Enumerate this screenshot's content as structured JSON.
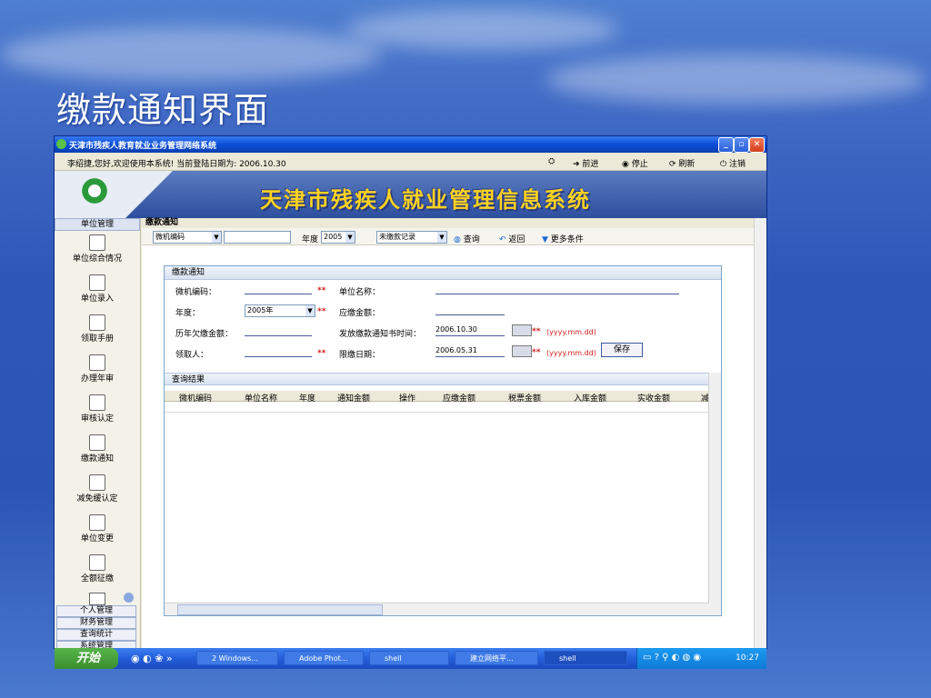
{
  "slide_title": "缴款通知界面",
  "window": {
    "title": "天津市残疾人教育就业业务管理网络系统"
  },
  "menubar": {
    "welcome": "李绍捷,您好,欢迎使用本系统! 当前登陆日期为: 2006.10.30",
    "actions": [
      "前进",
      "停止",
      "刷新",
      "注销"
    ]
  },
  "banner": {
    "title": "天津市残疾人就业管理信息系统"
  },
  "sidebar": {
    "header": "单位管理",
    "items": [
      {
        "label": "单位综合情况",
        "icon": "clip-icon"
      },
      {
        "label": "单位录入",
        "icon": "folder-icon"
      },
      {
        "label": "领取手册",
        "icon": "book-icon"
      },
      {
        "label": "办理年审",
        "icon": "document-icon"
      },
      {
        "label": "审核认定",
        "icon": "review-icon"
      },
      {
        "label": "缴款通知",
        "icon": "notice-icon"
      },
      {
        "label": "减免缓认定",
        "icon": "form-icon"
      },
      {
        "label": "单位变更",
        "icon": "network-icon"
      },
      {
        "label": "全额征缴",
        "icon": "document-icon"
      }
    ],
    "bottom": [
      "个人管理",
      "财务管理",
      "查询统计",
      "系统管理"
    ]
  },
  "main": {
    "header": "缴款通知",
    "toolbar": {
      "field_select": "微机编码",
      "year_label": "年度",
      "year_value": "2005",
      "status_select": "未缴款记录",
      "query": "查询",
      "back": "返回",
      "more": "更多条件"
    },
    "form": {
      "panel_title": "缴款通知",
      "code_label": "微机编码：",
      "unit_label": "单位名称：",
      "year_label": "年度：",
      "year_value": "2005年",
      "due_label": "应缴金额：",
      "arrears_label": "历年欠缴金额：",
      "issue_label": "发放缴款通知书时间：",
      "issue_value": "2006.10.30",
      "receiver_label": "领取人：",
      "deadline_label": "限缴日期：",
      "deadline_value": "2006.05.31",
      "required_mark": "**",
      "date_format": "(yyyy.mm.dd)",
      "save": "保存"
    },
    "results": {
      "title": "查询结果",
      "columns": [
        "微机编码",
        "单位名称",
        "年度",
        "通知金额",
        "操作",
        "应缴金额",
        "税票金额",
        "入库金额",
        "实收金额",
        "减"
      ]
    }
  },
  "taskbar": {
    "start": "开始",
    "tasks": [
      "2 Windows...",
      "Adobe Phot...",
      "shell",
      "建立网络平...",
      "shell"
    ],
    "clock": "10:27"
  }
}
